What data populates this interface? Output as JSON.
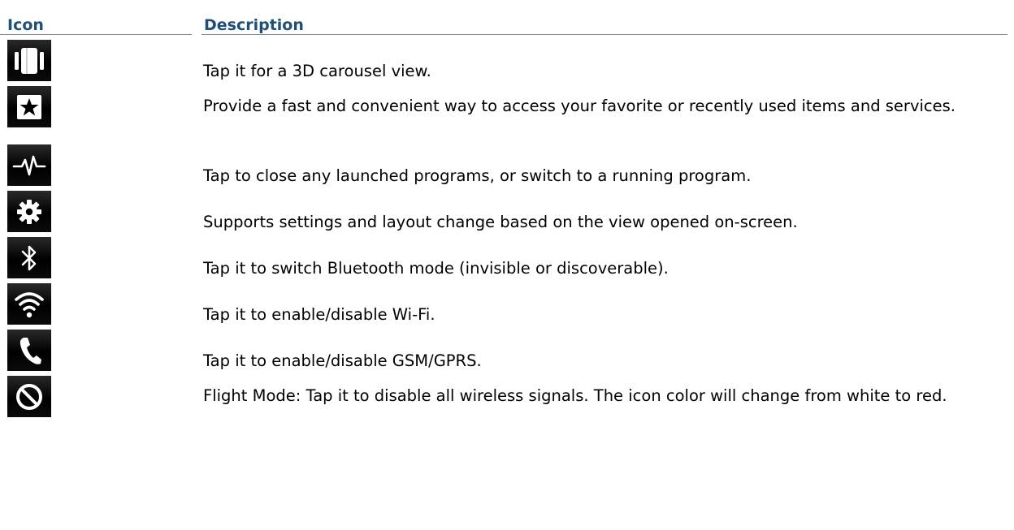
{
  "table": {
    "headers": {
      "icon": "Icon",
      "description": "Description"
    },
    "rows": [
      {
        "icon_name": "carousel-icon",
        "description": "Tap it for a 3D carousel view."
      },
      {
        "icon_name": "favorites-star-icon",
        "description": "Provide a fast and convenient way to access your favorite or recently used items and services."
      },
      {
        "icon_name": "task-manager-pulse-icon",
        "description": "Tap to close any launched programs, or switch to a running program."
      },
      {
        "icon_name": "gear-icon",
        "description": "Supports settings and layout change based on the view opened on-screen."
      },
      {
        "icon_name": "bluetooth-icon",
        "description": "Tap it to switch Bluetooth mode (invisible or discoverable)."
      },
      {
        "icon_name": "wifi-icon",
        "description": "Tap it to enable/disable Wi-Fi."
      },
      {
        "icon_name": "phone-icon",
        "description": "Tap it to enable/disable GSM/GPRS."
      },
      {
        "icon_name": "flight-mode-icon",
        "description": "Flight Mode: Tap it to disable all wireless signals. The icon color will change from white to red."
      }
    ]
  },
  "colors": {
    "header_text": "#1f4e79",
    "icon_background": "#000000",
    "icon_foreground": "#ffffff"
  }
}
